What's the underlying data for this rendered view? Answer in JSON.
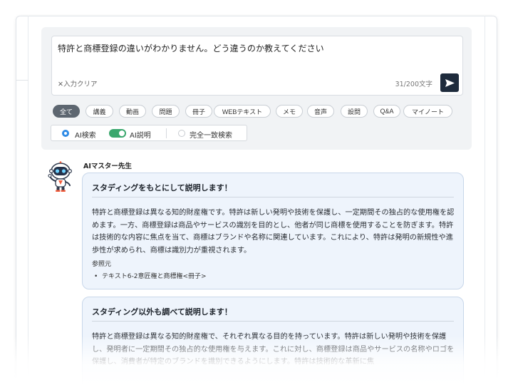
{
  "search": {
    "query": "特許と商標登録の違いがわかりません。どう違うのか教えてください",
    "clear_label": "✕入力クリア",
    "counter": "31/200文字",
    "send_icon": "send-icon"
  },
  "filters": [
    "全て",
    "講義",
    "動画",
    "問題",
    "冊子",
    "WEBテキスト",
    "メモ",
    "音声",
    "設問",
    "Q&A",
    "マイノート"
  ],
  "filters_active": "全て",
  "modes": {
    "ai_search": "AI検索",
    "ai_explain": "AI説明",
    "exact": "完全一致検索",
    "ai_search_selected": true,
    "ai_explain_on": true
  },
  "assistant": {
    "name": "AIマスター先生"
  },
  "answers": [
    {
      "heading": "スタディングをもとにして説明します！",
      "body": "特許と商標登録は異なる知的財産権です。特許は新しい発明や技術を保護し、一定期間その独占的な使用権を認めます。一方、商標登録は商品やサービスの識別を目的とし、他者が同じ商標を使用することを防ぎます。特許は技術的な内容に焦点を当て、商標はブランドや名称に関連しています。これにより、特許は発明の新規性や進歩性が求められ、商標は識別力が重視されます。",
      "ref_title": "参照元",
      "ref_item": "テキスト6-2意匠権と商標権<冊子>"
    },
    {
      "heading": "スタディング以外も調べて説明します！",
      "body": "特許と商標登録は異なる知的財産権で、それぞれ異なる目的を持っています。特許は新しい発明や技術を保護し、発明者に一定期間その独占的な使用権を与えます。これに対し、商標登録は商品やサービスの名称やロゴを保護し、消費者が特定のブランドを識別できるようにします。特許は技術的な革新に焦"
    }
  ],
  "colors": {
    "accent": "#2f8be6",
    "toggle": "#3aa76d",
    "card_bg": "#eef4fc",
    "send_bg": "#1e2b3c"
  }
}
